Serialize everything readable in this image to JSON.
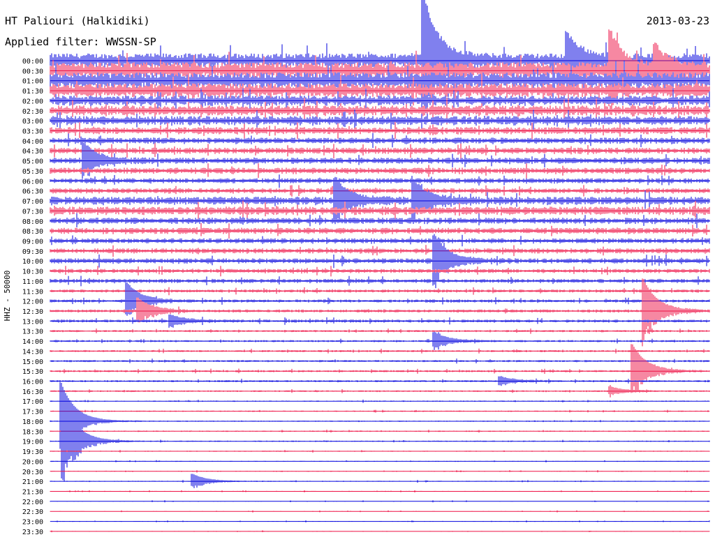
{
  "header": {
    "station": "HT Paliouri (Halkidiki)",
    "date": "2013-03-23",
    "filter": "Applied filter: WWSSN-SP"
  },
  "side_label": "HHZ - 50000",
  "colors": {
    "odd_trace": "#0000dd",
    "even_trace": "#ee1144",
    "text": "#000000"
  },
  "chart_data": {
    "type": "line",
    "subtype": "helicorder",
    "ylabel": "HHZ - 50000",
    "rows": [
      "00:00",
      "00:30",
      "01:00",
      "01:30",
      "02:00",
      "02:30",
      "03:00",
      "03:30",
      "04:00",
      "04:30",
      "05:00",
      "05:30",
      "06:00",
      "06:30",
      "07:00",
      "07:30",
      "08:00",
      "08:30",
      "09:00",
      "09:30",
      "10:00",
      "10:30",
      "11:00",
      "11:30",
      "12:00",
      "12:30",
      "13:00",
      "13:30",
      "14:00",
      "14:30",
      "15:00",
      "15:30",
      "16:00",
      "16:30",
      "17:00",
      "17:30",
      "18:00",
      "18:30",
      "19:00",
      "19:30",
      "20:00",
      "20:30",
      "21:00",
      "21:30",
      "22:00",
      "22:30",
      "23:00",
      "23:30"
    ],
    "row_minutes": 30,
    "noise_amplitude": [
      7,
      8,
      8,
      7,
      5,
      5,
      4.5,
      3.5,
      3,
      3,
      3,
      3,
      2.5,
      2.5,
      4,
      4,
      3,
      3,
      2.5,
      2.5,
      2.5,
      2,
      2,
      1.5,
      1.5,
      1.5,
      1.5,
      1,
      1,
      1,
      1,
      1,
      1,
      0.8,
      0.6,
      0.6,
      0.6,
      0.6,
      0.6,
      0.5,
      0.5,
      0.5,
      0.5,
      0.4,
      0.4,
      0.4,
      0.4,
      0.4
    ],
    "events": [
      {
        "row": 0,
        "minute": 17,
        "amplitude": 90
      },
      {
        "row": 0,
        "minute": 23.5,
        "amplitude": 35
      },
      {
        "row": 1,
        "minute": 25.5,
        "amplitude": 50
      },
      {
        "row": 1,
        "minute": 27.5,
        "amplitude": 30
      },
      {
        "row": 10,
        "minute": 1.5,
        "amplitude": 25
      },
      {
        "row": 14,
        "minute": 13,
        "amplitude": 30
      },
      {
        "row": 14,
        "minute": 16.5,
        "amplitude": 30
      },
      {
        "row": 20,
        "minute": 17.5,
        "amplitude": 35
      },
      {
        "row": 24,
        "minute": 3.5,
        "amplitude": 25
      },
      {
        "row": 25,
        "minute": 4,
        "amplitude": 18
      },
      {
        "row": 26,
        "minute": 5.5,
        "amplitude": 8
      },
      {
        "row": 25,
        "minute": 27,
        "amplitude": 45
      },
      {
        "row": 28,
        "minute": 17.5,
        "amplitude": 12
      },
      {
        "row": 31,
        "minute": 26.5,
        "amplitude": 38
      },
      {
        "row": 32,
        "minute": 20.5,
        "amplitude": 6
      },
      {
        "row": 33,
        "minute": 25.5,
        "amplitude": 6
      },
      {
        "row": 36,
        "minute": 0.5,
        "amplitude": 55
      },
      {
        "row": 38,
        "minute": 0.6,
        "amplitude": 60
      },
      {
        "row": 42,
        "minute": 6.5,
        "amplitude": 10
      }
    ]
  }
}
